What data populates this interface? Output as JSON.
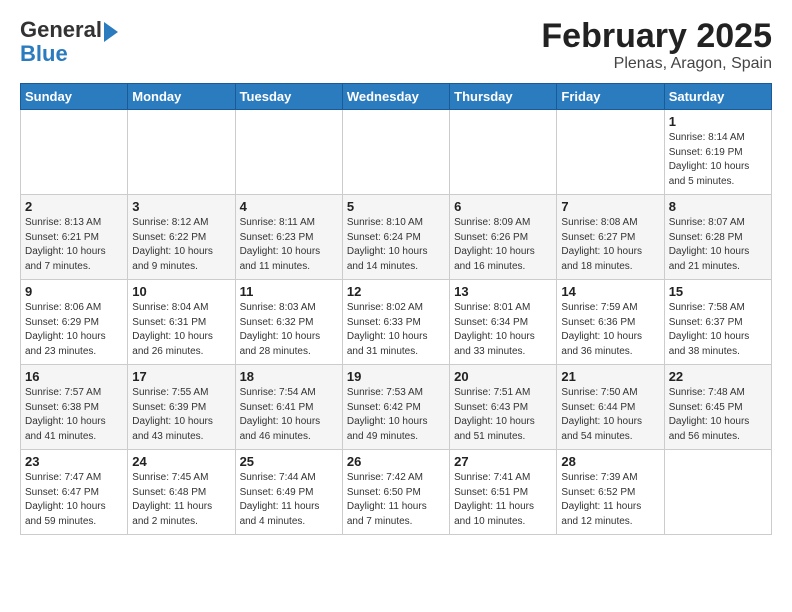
{
  "logo": {
    "line1": "General",
    "line2": "Blue"
  },
  "title": "February 2025",
  "subtitle": "Plenas, Aragon, Spain",
  "days_of_week": [
    "Sunday",
    "Monday",
    "Tuesday",
    "Wednesday",
    "Thursday",
    "Friday",
    "Saturday"
  ],
  "weeks": [
    [
      {
        "day": "",
        "info": ""
      },
      {
        "day": "",
        "info": ""
      },
      {
        "day": "",
        "info": ""
      },
      {
        "day": "",
        "info": ""
      },
      {
        "day": "",
        "info": ""
      },
      {
        "day": "",
        "info": ""
      },
      {
        "day": "1",
        "info": "Sunrise: 8:14 AM\nSunset: 6:19 PM\nDaylight: 10 hours\nand 5 minutes."
      }
    ],
    [
      {
        "day": "2",
        "info": "Sunrise: 8:13 AM\nSunset: 6:21 PM\nDaylight: 10 hours\nand 7 minutes."
      },
      {
        "day": "3",
        "info": "Sunrise: 8:12 AM\nSunset: 6:22 PM\nDaylight: 10 hours\nand 9 minutes."
      },
      {
        "day": "4",
        "info": "Sunrise: 8:11 AM\nSunset: 6:23 PM\nDaylight: 10 hours\nand 11 minutes."
      },
      {
        "day": "5",
        "info": "Sunrise: 8:10 AM\nSunset: 6:24 PM\nDaylight: 10 hours\nand 14 minutes."
      },
      {
        "day": "6",
        "info": "Sunrise: 8:09 AM\nSunset: 6:26 PM\nDaylight: 10 hours\nand 16 minutes."
      },
      {
        "day": "7",
        "info": "Sunrise: 8:08 AM\nSunset: 6:27 PM\nDaylight: 10 hours\nand 18 minutes."
      },
      {
        "day": "8",
        "info": "Sunrise: 8:07 AM\nSunset: 6:28 PM\nDaylight: 10 hours\nand 21 minutes."
      }
    ],
    [
      {
        "day": "9",
        "info": "Sunrise: 8:06 AM\nSunset: 6:29 PM\nDaylight: 10 hours\nand 23 minutes."
      },
      {
        "day": "10",
        "info": "Sunrise: 8:04 AM\nSunset: 6:31 PM\nDaylight: 10 hours\nand 26 minutes."
      },
      {
        "day": "11",
        "info": "Sunrise: 8:03 AM\nSunset: 6:32 PM\nDaylight: 10 hours\nand 28 minutes."
      },
      {
        "day": "12",
        "info": "Sunrise: 8:02 AM\nSunset: 6:33 PM\nDaylight: 10 hours\nand 31 minutes."
      },
      {
        "day": "13",
        "info": "Sunrise: 8:01 AM\nSunset: 6:34 PM\nDaylight: 10 hours\nand 33 minutes."
      },
      {
        "day": "14",
        "info": "Sunrise: 7:59 AM\nSunset: 6:36 PM\nDaylight: 10 hours\nand 36 minutes."
      },
      {
        "day": "15",
        "info": "Sunrise: 7:58 AM\nSunset: 6:37 PM\nDaylight: 10 hours\nand 38 minutes."
      }
    ],
    [
      {
        "day": "16",
        "info": "Sunrise: 7:57 AM\nSunset: 6:38 PM\nDaylight: 10 hours\nand 41 minutes."
      },
      {
        "day": "17",
        "info": "Sunrise: 7:55 AM\nSunset: 6:39 PM\nDaylight: 10 hours\nand 43 minutes."
      },
      {
        "day": "18",
        "info": "Sunrise: 7:54 AM\nSunset: 6:41 PM\nDaylight: 10 hours\nand 46 minutes."
      },
      {
        "day": "19",
        "info": "Sunrise: 7:53 AM\nSunset: 6:42 PM\nDaylight: 10 hours\nand 49 minutes."
      },
      {
        "day": "20",
        "info": "Sunrise: 7:51 AM\nSunset: 6:43 PM\nDaylight: 10 hours\nand 51 minutes."
      },
      {
        "day": "21",
        "info": "Sunrise: 7:50 AM\nSunset: 6:44 PM\nDaylight: 10 hours\nand 54 minutes."
      },
      {
        "day": "22",
        "info": "Sunrise: 7:48 AM\nSunset: 6:45 PM\nDaylight: 10 hours\nand 56 minutes."
      }
    ],
    [
      {
        "day": "23",
        "info": "Sunrise: 7:47 AM\nSunset: 6:47 PM\nDaylight: 10 hours\nand 59 minutes."
      },
      {
        "day": "24",
        "info": "Sunrise: 7:45 AM\nSunset: 6:48 PM\nDaylight: 11 hours\nand 2 minutes."
      },
      {
        "day": "25",
        "info": "Sunrise: 7:44 AM\nSunset: 6:49 PM\nDaylight: 11 hours\nand 4 minutes."
      },
      {
        "day": "26",
        "info": "Sunrise: 7:42 AM\nSunset: 6:50 PM\nDaylight: 11 hours\nand 7 minutes."
      },
      {
        "day": "27",
        "info": "Sunrise: 7:41 AM\nSunset: 6:51 PM\nDaylight: 11 hours\nand 10 minutes."
      },
      {
        "day": "28",
        "info": "Sunrise: 7:39 AM\nSunset: 6:52 PM\nDaylight: 11 hours\nand 12 minutes."
      },
      {
        "day": "",
        "info": ""
      }
    ]
  ]
}
